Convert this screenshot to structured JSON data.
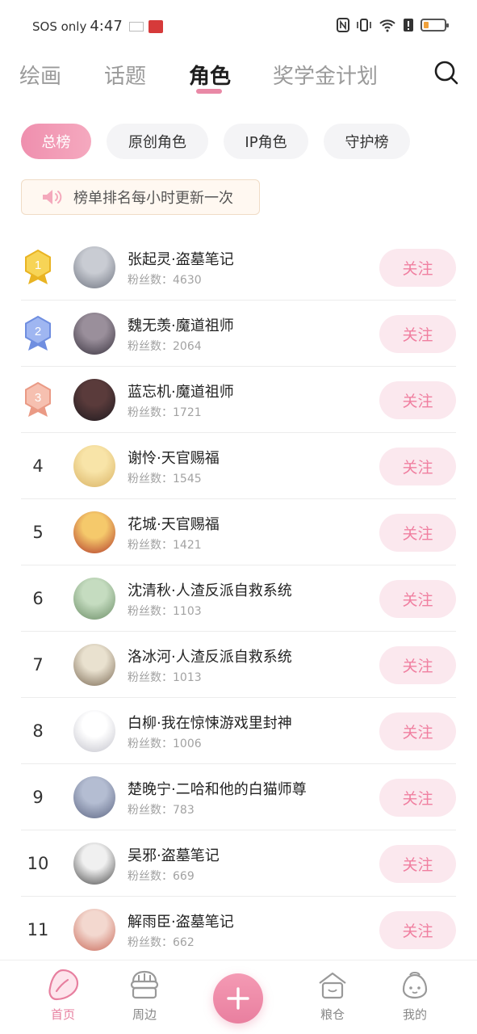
{
  "status_bar": {
    "carrier": "SOS only",
    "time": "4:47"
  },
  "top_tabs": [
    {
      "label": "绘画",
      "active": false
    },
    {
      "label": "话题",
      "active": false
    },
    {
      "label": "角色",
      "active": true
    },
    {
      "label": "奖学金计划",
      "active": false
    }
  ],
  "filter_chips": [
    {
      "label": "总榜",
      "active": true
    },
    {
      "label": "原创角色",
      "active": false
    },
    {
      "label": "IP角色",
      "active": false
    },
    {
      "label": "守护榜",
      "active": false
    }
  ],
  "notice": {
    "text": "榜单排名每小时更新一次",
    "icon": "speaker-icon"
  },
  "fans_prefix": "粉丝数：",
  "follow_label": "关注",
  "rankings": [
    {
      "rank": "1",
      "name": "张起灵·盗墓笔记",
      "fans": "粉丝数：4630",
      "medal": "gold"
    },
    {
      "rank": "2",
      "name": "魏无羡·魔道祖师",
      "fans": "粉丝数：2064",
      "medal": "silver"
    },
    {
      "rank": "3",
      "name": "蓝忘机·魔道祖师",
      "fans": "粉丝数：1721",
      "medal": "bronze"
    },
    {
      "rank": "4",
      "name": "谢怜·天官赐福",
      "fans": "粉丝数：1545"
    },
    {
      "rank": "5",
      "name": "花城·天官赐福",
      "fans": "粉丝数：1421"
    },
    {
      "rank": "6",
      "name": "沈清秋·人渣反派自救系统",
      "fans": "粉丝数：1103"
    },
    {
      "rank": "7",
      "name": "洛冰河·人渣反派自救系统",
      "fans": "粉丝数：1013"
    },
    {
      "rank": "8",
      "name": "白柳·我在惊悚游戏里封神",
      "fans": "粉丝数：1006"
    },
    {
      "rank": "9",
      "name": "楚晚宁·二哈和他的白猫师尊",
      "fans": "粉丝数：783"
    },
    {
      "rank": "10",
      "name": "吴邪·盗墓笔记",
      "fans": "粉丝数：669"
    },
    {
      "rank": "11",
      "name": "解雨臣·盗墓笔记",
      "fans": "粉丝数：662"
    }
  ],
  "bottom_nav": [
    {
      "label": "首页",
      "icon": "home-petal-icon",
      "active": true
    },
    {
      "label": "周边",
      "icon": "store-icon",
      "active": false
    },
    {
      "label": "",
      "icon": "plus-icon",
      "active": false
    },
    {
      "label": "粮仓",
      "icon": "barn-icon",
      "active": false
    },
    {
      "label": "我的",
      "icon": "bun-face-icon",
      "active": false
    }
  ],
  "colors": {
    "accent": "#e989a6",
    "follow_bg": "#fbe8ee",
    "follow_text": "#f07fa0",
    "gold": "#f5c73d",
    "silver": "#7f9be6",
    "bronze": "#f0a894"
  }
}
